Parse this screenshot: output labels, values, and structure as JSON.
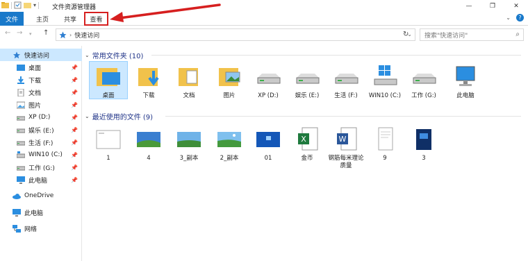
{
  "window": {
    "title": "文件资源管理器",
    "controls": [
      "—",
      "❐",
      "✕"
    ]
  },
  "ribbon": {
    "tabs": [
      "文件",
      "主页",
      "共享",
      "查看"
    ],
    "expand_icon": "chevron-down-icon",
    "help_icon": "help-icon"
  },
  "address": {
    "path": "快速访问",
    "search_placeholder": "搜索\"快速访问\""
  },
  "sidebar": {
    "quick_access": "快速访问",
    "items": [
      {
        "label": "桌面",
        "pinned": true
      },
      {
        "label": "下载",
        "pinned": true
      },
      {
        "label": "文档",
        "pinned": true
      },
      {
        "label": "图片",
        "pinned": true
      },
      {
        "label": "XP (D:)",
        "pinned": true
      },
      {
        "label": "娱乐 (E:)",
        "pinned": true
      },
      {
        "label": "生活 (F:)",
        "pinned": true
      },
      {
        "label": "WIN10 (C:)",
        "pinned": true
      },
      {
        "label": "工作 (G:)",
        "pinned": true
      },
      {
        "label": "此电脑",
        "pinned": true
      }
    ],
    "onedrive": "OneDrive",
    "this_pc": "此电脑",
    "network": "网络"
  },
  "frequent": {
    "header": "常用文件夹 (10)",
    "items": [
      "桌面",
      "下载",
      "文档",
      "图片",
      "XP (D:)",
      "娱乐 (E:)",
      "生活 (F:)",
      "WIN10 (C:)",
      "工作 (G:)",
      "此电脑"
    ]
  },
  "recent": {
    "header": "最近使用的文件 (9)",
    "items": [
      "1",
      "4",
      "3_副本",
      "2_副本",
      "01",
      "金币",
      "钢筋每米理论质量",
      "9",
      "3"
    ]
  },
  "colors": {
    "accent": "#1979ca",
    "highlight": "#d61f1f",
    "selected_bg": "#cce8ff",
    "group_header": "#1e3287"
  }
}
